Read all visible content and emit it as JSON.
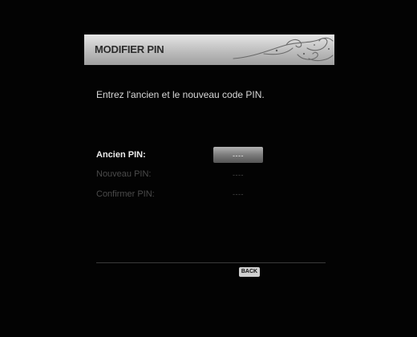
{
  "dialog": {
    "title": "MODIFIER PIN",
    "instruction": "Entrez l'ancien et le nouveau code PIN."
  },
  "fields": [
    {
      "label": "Ancien PIN:",
      "value": "----",
      "state": "focused"
    },
    {
      "label": "Nouveau PIN:",
      "value": "----",
      "state": "inactive"
    },
    {
      "label": "Confirmer PIN:",
      "value": "----",
      "state": "inactive"
    }
  ],
  "footer": {
    "back_label": "BACK"
  },
  "colors": {
    "background": "#030303",
    "header_gradient_top": "#e6e6e6",
    "header_gradient_bottom": "#9f9f9f",
    "active_text": "#ededed",
    "inactive_text": "#4b4b4b",
    "focus_box": "#7c7c7c"
  },
  "icons": {
    "header_decoration": "swirl-ornament-icon"
  }
}
